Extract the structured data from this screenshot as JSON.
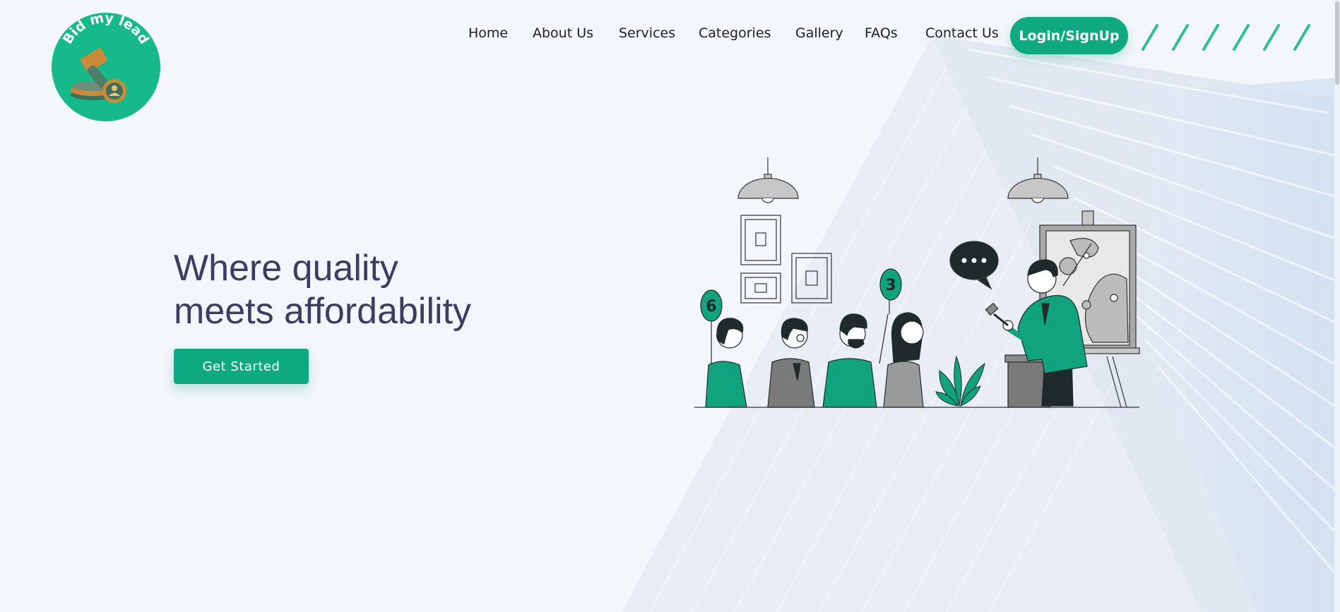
{
  "brand": {
    "logo_text": "Bid my lead",
    "accent_color": "#0fa981"
  },
  "nav": {
    "items": [
      {
        "label": "Home"
      },
      {
        "label": "About Us"
      },
      {
        "label": "Services"
      },
      {
        "label": "Categories"
      },
      {
        "label": "Gallery"
      },
      {
        "label": "FAQs"
      },
      {
        "label": "Contact Us"
      }
    ],
    "login_label": "Login/SignUp"
  },
  "hero": {
    "title_line1": "Where quality",
    "title_line2": "meets affordability",
    "cta_label": "Get Started",
    "paddles": [
      "6",
      "3"
    ]
  }
}
